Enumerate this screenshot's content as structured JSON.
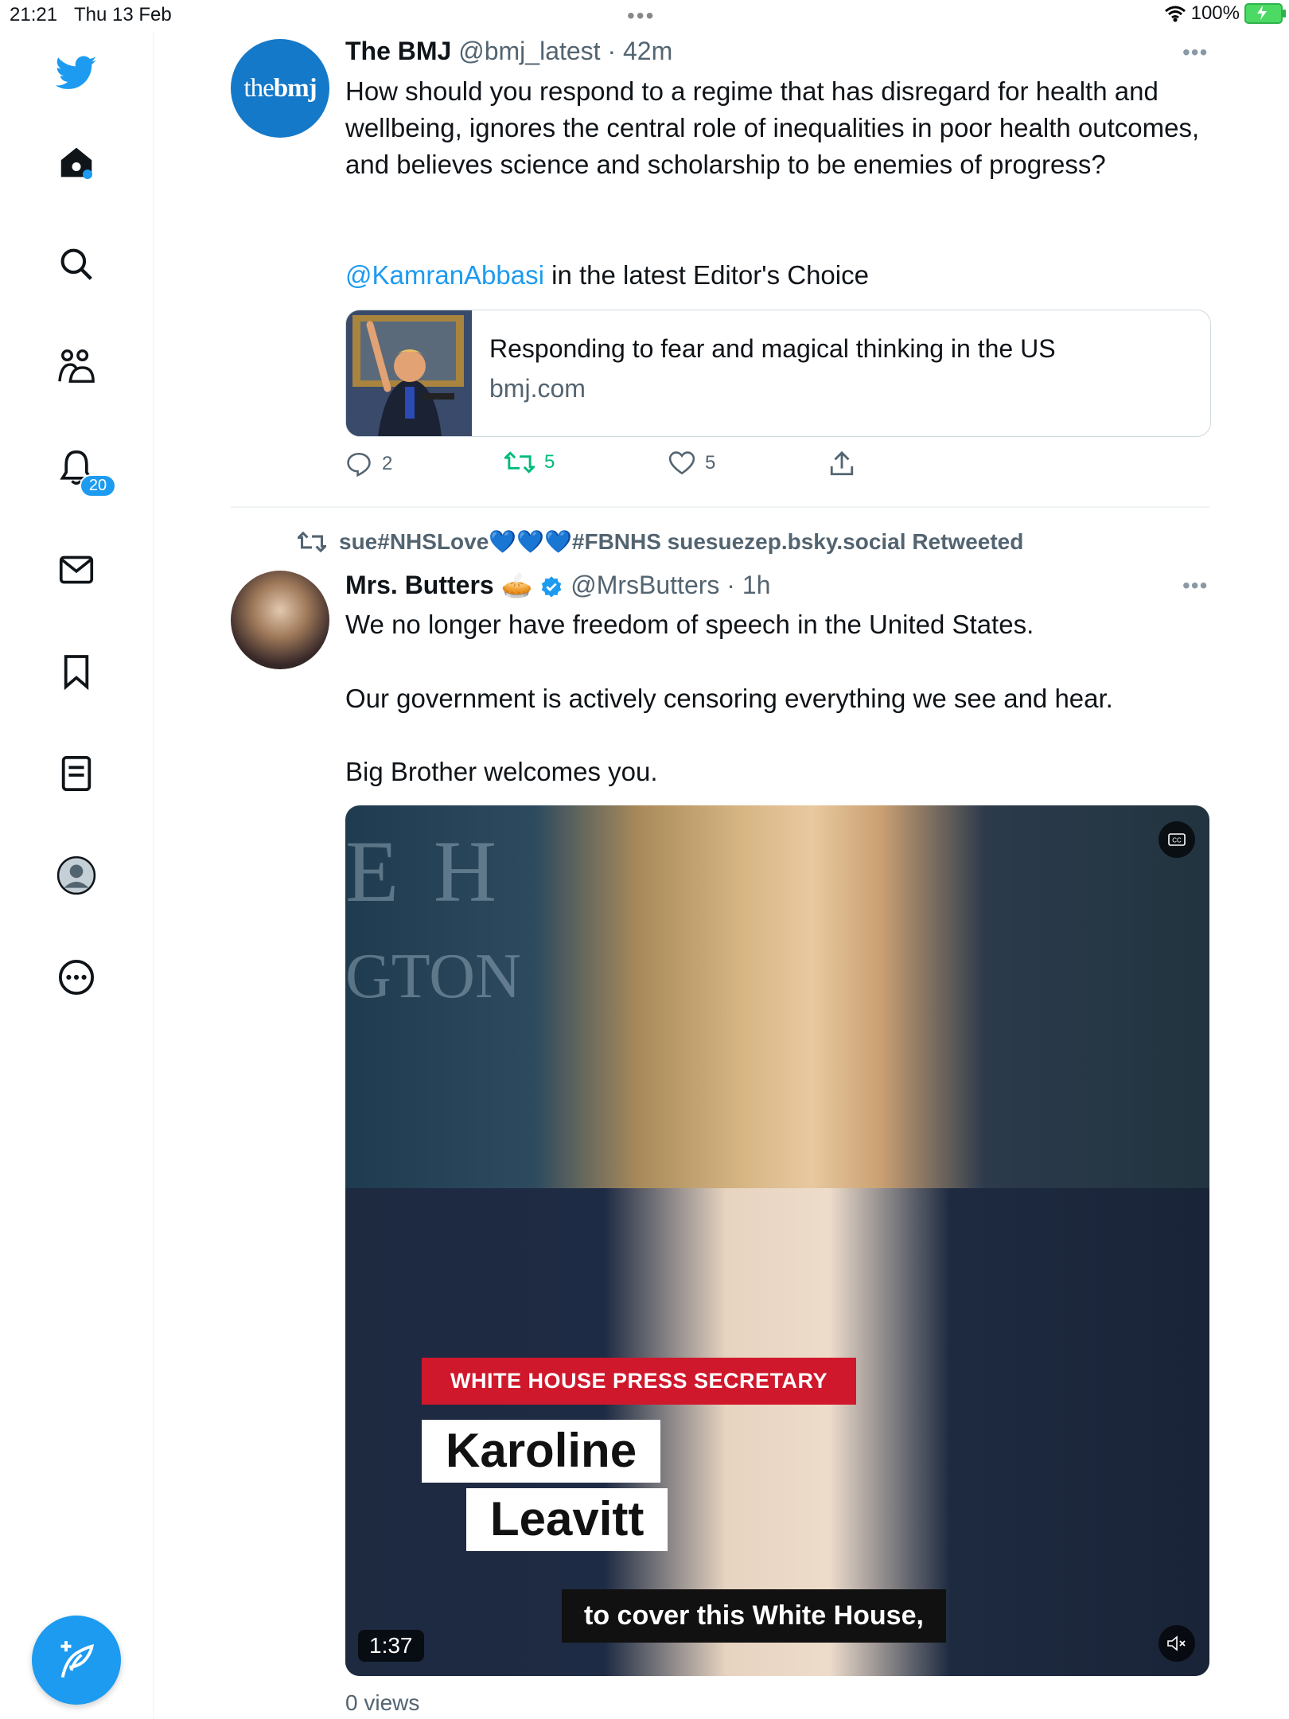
{
  "status_bar": {
    "time": "21:21",
    "date": "Thu 13 Feb",
    "battery": "100%"
  },
  "sidebar": {
    "items": [
      {
        "icon": "twitter-bird-icon"
      },
      {
        "icon": "home-icon"
      },
      {
        "icon": "search-icon"
      },
      {
        "icon": "communities-icon"
      },
      {
        "icon": "notifications-icon",
        "badge": "20"
      },
      {
        "icon": "messages-icon"
      },
      {
        "icon": "bookmarks-icon"
      },
      {
        "icon": "lists-icon"
      },
      {
        "icon": "profile-icon"
      },
      {
        "icon": "more-icon"
      }
    ],
    "compose_icon": "compose-tweet-icon"
  },
  "tweets": [
    {
      "avatar_text_light": "the",
      "avatar_text_bold": "bmj",
      "name": "The BMJ",
      "handle": "@bmj_latest",
      "time": "· 42m",
      "text": "How should you respond to a regime that has disregard for health and wellbeing, ignores the central role of inequalities in poor health outcomes, and believes science and scholarship to be enemies of progress?",
      "mention": "@KamranAbbasi",
      "mention_suffix": " in the latest Editor's Choice",
      "card": {
        "title": "Responding to fear and magical thinking in the US",
        "domain": "bmj.com"
      },
      "replies": "2",
      "retweets": "5",
      "likes": "5"
    },
    {
      "retweeted_by": "sue#NHSLove",
      "retweeted_hearts": "💙💙💙",
      "retweeted_suffix": "#FBNHS suesuezep.bsky.social Retweeted",
      "name": "Mrs. Butters",
      "name_emoji": "🥧",
      "handle": "@MrsButters",
      "time": "· 1h",
      "lines": [
        "We no longer have freedom of speech in the United States.",
        "Our government is actively censoring everything we see and hear.",
        "Big Brother welcomes you."
      ],
      "video": {
        "bg_text_top": "E H",
        "bg_text_mid": "GTON",
        "lower_third_title": "WHITE HOUSE PRESS SECRETARY",
        "lower_third_name1": "Karoline",
        "lower_third_name2": "Leavitt",
        "caption": "to cover this White House,",
        "duration": "1:37"
      },
      "views": "0 views"
    }
  ],
  "colors": {
    "accent": "#1d9bf0",
    "retweet_green": "#00ba7c",
    "text": "#0f1419",
    "muted": "#536471"
  }
}
